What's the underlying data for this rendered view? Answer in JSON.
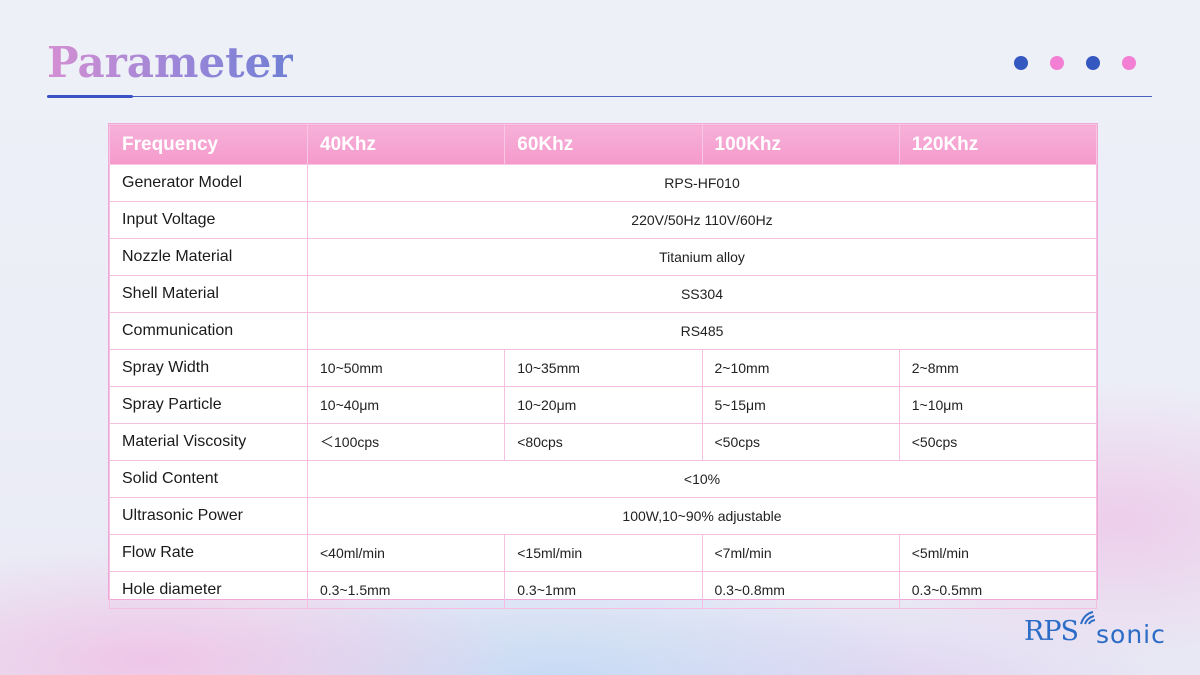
{
  "page": {
    "title": "Parameter"
  },
  "decor": {
    "dot_colors": [
      "#3558c0",
      "#f27fd3",
      "#3558c0",
      "#f27fd3"
    ]
  },
  "table": {
    "headers": [
      "Frequency",
      "40Khz",
      "60Khz",
      "100Khz",
      "120Khz"
    ],
    "rows": [
      {
        "label": "Generator Model",
        "span": true,
        "value": "RPS-HF010"
      },
      {
        "label": "Input Voltage",
        "span": true,
        "value": "220V/50Hz  110V/60Hz"
      },
      {
        "label": "Nozzle Material",
        "span": true,
        "value": "Titanium alloy"
      },
      {
        "label": "Shell Material",
        "span": true,
        "value": "SS304"
      },
      {
        "label": "Communication",
        "span": true,
        "value": "RS485"
      },
      {
        "label": "Spray Width",
        "span": false,
        "values": [
          "10~50mm",
          "10~35mm",
          "2~10mm",
          "2~8mm"
        ]
      },
      {
        "label": "Spray Particle",
        "span": false,
        "values": [
          "10~40μm",
          "10~20μm",
          "5~15μm",
          "1~10μm"
        ]
      },
      {
        "label": "Material Viscosity",
        "span": false,
        "values": [
          "＜100cps",
          "<80cps",
          "<50cps",
          "<50cps"
        ]
      },
      {
        "label": "Solid Content",
        "span": true,
        "value": "<10%"
      },
      {
        "label": "Ultrasonic Power",
        "span": true,
        "value": "100W,10~90% adjustable"
      },
      {
        "label": "Flow Rate",
        "span": false,
        "values": [
          "<40ml/min",
          "<15ml/min",
          "<7ml/min",
          "<5ml/min"
        ]
      },
      {
        "label": "Hole diameter",
        "span": false,
        "values": [
          "0.3~1.5mm",
          "0.3~1mm",
          "0.3~0.8mm",
          "0.3~0.5mm"
        ]
      }
    ]
  },
  "logo": {
    "part1": "RPS",
    "part2": "sonic",
    "color": "#2a6cc6"
  }
}
